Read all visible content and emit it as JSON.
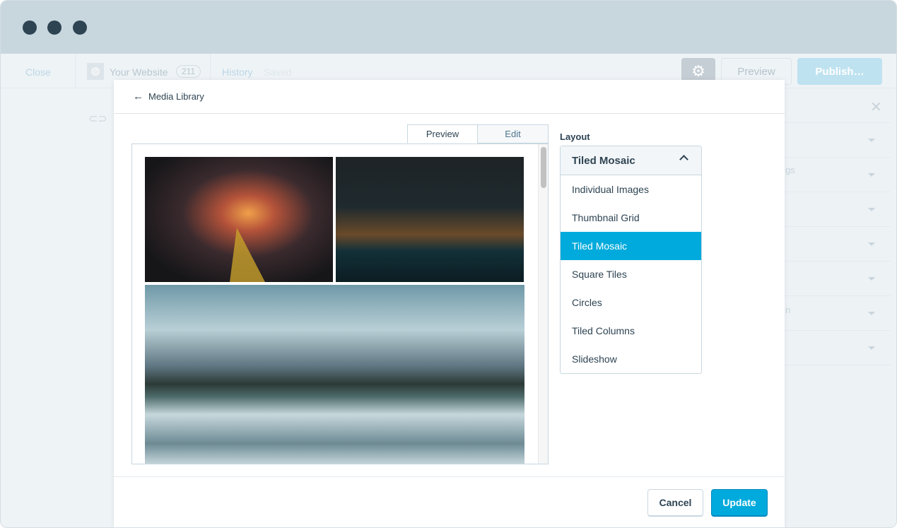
{
  "window": {
    "dots": [
      "close",
      "minimize",
      "maximize"
    ]
  },
  "appbar": {
    "close": "Close",
    "site_name": "Your Website",
    "count": "211",
    "history": "History",
    "saved": "Saved",
    "preview": "Preview",
    "publish": "Publish…"
  },
  "side_panel": {
    "fragments": [
      "",
      "gs",
      "",
      "",
      "",
      "n",
      ""
    ]
  },
  "modal": {
    "back_label": "Media Library",
    "tabs": [
      {
        "label": "Preview",
        "active": true
      },
      {
        "label": "Edit",
        "active": false
      }
    ],
    "layout_label": "Layout",
    "layout_selected": "Tiled Mosaic",
    "layout_options": [
      "Individual Images",
      "Thumbnail Grid",
      "Tiled Mosaic",
      "Square Tiles",
      "Circles",
      "Tiled Columns",
      "Slideshow"
    ],
    "cancel": "Cancel",
    "update": "Update"
  },
  "colors": {
    "accent": "#00aadc",
    "text": "#2e4453"
  }
}
